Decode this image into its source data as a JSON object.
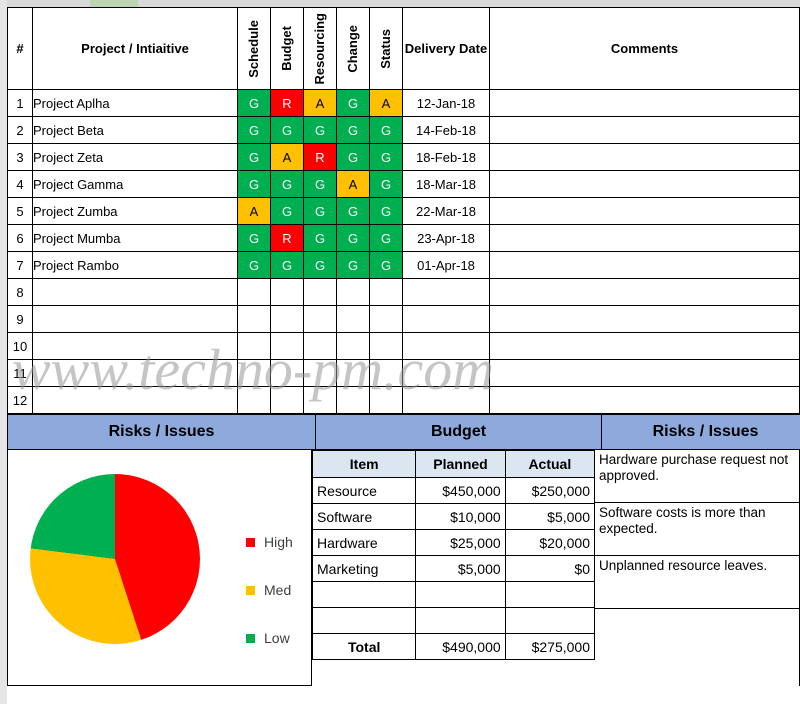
{
  "watermark": "www.techno-pm.com",
  "colors": {
    "green": "#00B050",
    "amber": "#FFC000",
    "red": "#FF0000",
    "header_blue": "#8EA9DB",
    "header_yellow": "#FFD966",
    "rot_header_blue": "#DCE6F1",
    "date_header_blue": "#B8CCE4"
  },
  "projects_table": {
    "headers": {
      "num": "#",
      "project": "Project / Intiaitive",
      "schedule": "Schedule",
      "budget": "Budget",
      "resourcing": "Resourcing",
      "change": "Change",
      "status": "Status",
      "delivery_date": "Delivery Date",
      "comments": "Comments"
    },
    "rows": [
      {
        "num": "1",
        "project": "Project Aplha",
        "schedule": "G",
        "budget": "R",
        "resourcing": "A",
        "change": "G",
        "status": "A",
        "date": "12-Jan-18",
        "comment": ""
      },
      {
        "num": "2",
        "project": "Project Beta",
        "schedule": "G",
        "budget": "G",
        "resourcing": "G",
        "change": "G",
        "status": "G",
        "date": "14-Feb-18",
        "comment": ""
      },
      {
        "num": "3",
        "project": "Project Zeta",
        "schedule": "G",
        "budget": "A",
        "resourcing": "R",
        "change": "G",
        "status": "G",
        "date": "18-Feb-18",
        "comment": ""
      },
      {
        "num": "4",
        "project": "Project Gamma",
        "schedule": "G",
        "budget": "G",
        "resourcing": "G",
        "change": "A",
        "status": "G",
        "date": "18-Mar-18",
        "comment": ""
      },
      {
        "num": "5",
        "project": "Project Zumba",
        "schedule": "A",
        "budget": "G",
        "resourcing": "G",
        "change": "G",
        "status": "G",
        "date": "22-Mar-18",
        "comment": ""
      },
      {
        "num": "6",
        "project": "Project Mumba",
        "schedule": "G",
        "budget": "R",
        "resourcing": "G",
        "change": "G",
        "status": "G",
        "date": "23-Apr-18",
        "comment": ""
      },
      {
        "num": "7",
        "project": "Project Rambo",
        "schedule": "G",
        "budget": "G",
        "resourcing": "G",
        "change": "G",
        "status": "G",
        "date": "01-Apr-18",
        "comment": ""
      },
      {
        "num": "8",
        "project": "",
        "schedule": "",
        "budget": "",
        "resourcing": "",
        "change": "",
        "status": "",
        "date": "",
        "comment": ""
      },
      {
        "num": "9",
        "project": "",
        "schedule": "",
        "budget": "",
        "resourcing": "",
        "change": "",
        "status": "",
        "date": "",
        "comment": ""
      },
      {
        "num": "10",
        "project": "",
        "schedule": "",
        "budget": "",
        "resourcing": "",
        "change": "",
        "status": "",
        "date": "",
        "comment": ""
      },
      {
        "num": "11",
        "project": "",
        "schedule": "",
        "budget": "",
        "resourcing": "",
        "change": "",
        "status": "",
        "date": "",
        "comment": ""
      },
      {
        "num": "12",
        "project": "",
        "schedule": "",
        "budget": "",
        "resourcing": "",
        "change": "",
        "status": "",
        "date": "",
        "comment": ""
      }
    ]
  },
  "sections": {
    "left": "Risks / Issues",
    "middle": "Budget",
    "right": "Risks / Issues"
  },
  "chart_data": {
    "type": "pie",
    "title": "Risks / Issues",
    "labels": [
      "High",
      "Med",
      "Low"
    ],
    "values": [
      45,
      32,
      23
    ],
    "colors": [
      "#FF0000",
      "#FFC000",
      "#00B050"
    ],
    "legend_position": "right",
    "start_angle_deg": 0,
    "direction": "clockwise"
  },
  "budget_table": {
    "headers": {
      "item": "Item",
      "planned": "Planned",
      "actual": "Actual"
    },
    "rows": [
      {
        "item": "Resource",
        "planned": "$450,000",
        "actual": "$250,000"
      },
      {
        "item": "Software",
        "planned": "$10,000",
        "actual": "$5,000"
      },
      {
        "item": "Hardware",
        "planned": "$25,000",
        "actual": "$20,000"
      },
      {
        "item": "Marketing",
        "planned": "$5,000",
        "actual": "$0"
      },
      {
        "item": "",
        "planned": "",
        "actual": ""
      },
      {
        "item": "",
        "planned": "",
        "actual": ""
      }
    ],
    "total": {
      "label": "Total",
      "planned": "$490,000",
      "actual": "$275,000"
    }
  },
  "risks": [
    "Hardware purchase request not approved.",
    "Software costs is more than expected.",
    "Unplanned resource leaves."
  ]
}
